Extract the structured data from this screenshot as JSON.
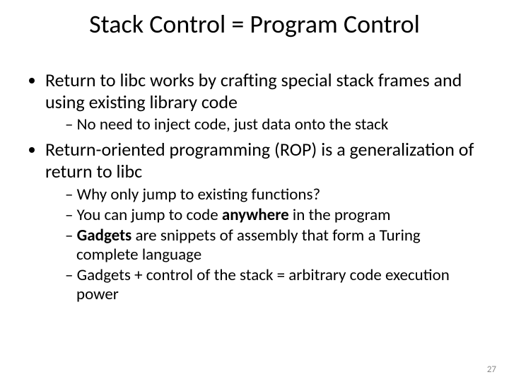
{
  "slide": {
    "title": "Stack Control = Program Control",
    "bullets": [
      {
        "text": "Return to libc works by crafting special stack frames and using existing library code",
        "sub": [
          {
            "text": "No need to inject code, just data onto the stack"
          }
        ]
      },
      {
        "text": "Return-oriented programming (ROP) is a generalization of return to libc",
        "sub": [
          {
            "text": "Why only jump to existing functions?"
          },
          {
            "prefix": "You can jump to code ",
            "bold": "anywhere",
            "suffix": " in the program"
          },
          {
            "lead": " ",
            "bold": "Gadgets",
            "suffix": " are snippets of assembly that form a Turing complete language"
          },
          {
            "text": "Gadgets + control of the stack = arbitrary code execution power"
          }
        ]
      }
    ],
    "page_number": "27"
  }
}
